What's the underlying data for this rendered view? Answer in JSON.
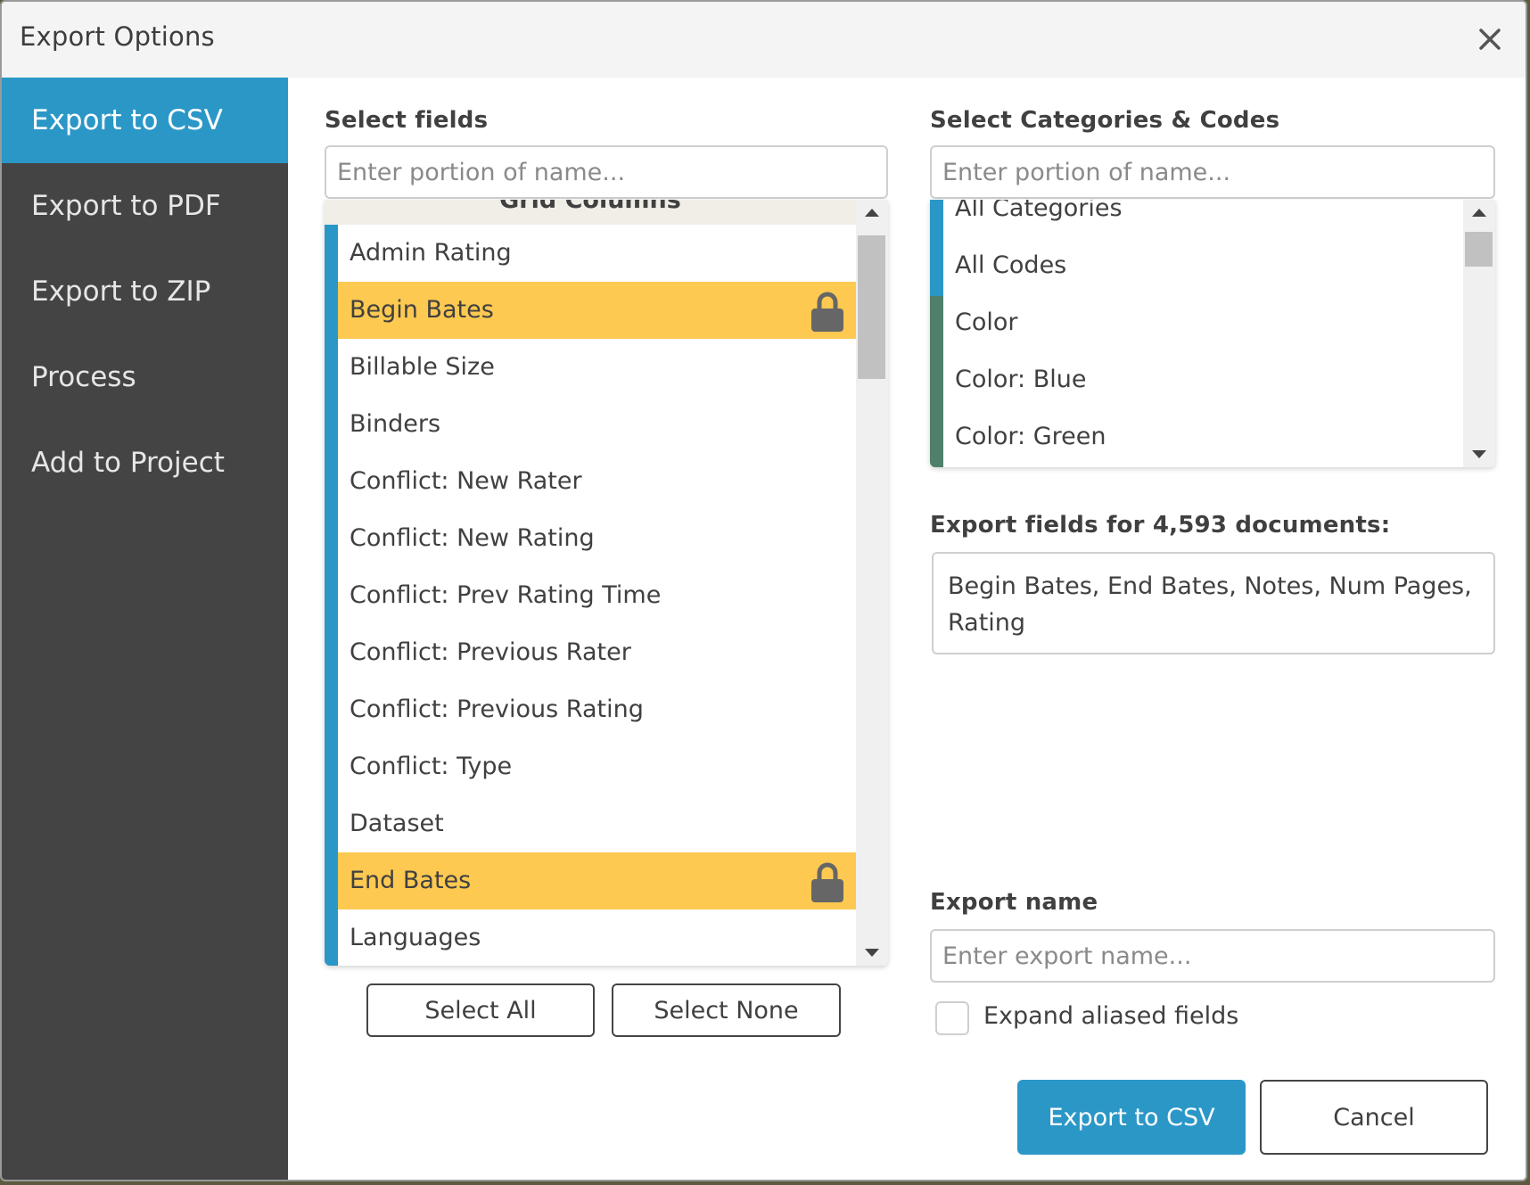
{
  "dialog": {
    "title": "Export Options",
    "close_icon": "close-icon"
  },
  "sidebar": {
    "items": [
      {
        "label": "Export to CSV",
        "active": true
      },
      {
        "label": "Export to PDF",
        "active": false
      },
      {
        "label": "Export to ZIP",
        "active": false
      },
      {
        "label": "Process",
        "active": false
      },
      {
        "label": "Add to Project",
        "active": false
      }
    ]
  },
  "fields": {
    "label": "Select fields",
    "search_placeholder": "Enter portion of name...",
    "group_header": "Grid Columns",
    "items": [
      {
        "label": "Admin Rating",
        "locked": false
      },
      {
        "label": "Begin Bates",
        "locked": true
      },
      {
        "label": "Billable Size",
        "locked": false
      },
      {
        "label": "Binders",
        "locked": false
      },
      {
        "label": "Conflict: New Rater",
        "locked": false
      },
      {
        "label": "Conflict: New Rating",
        "locked": false
      },
      {
        "label": "Conflict: Prev Rating Time",
        "locked": false
      },
      {
        "label": "Conflict: Previous Rater",
        "locked": false
      },
      {
        "label": "Conflict: Previous Rating",
        "locked": false
      },
      {
        "label": "Conflict: Type",
        "locked": false
      },
      {
        "label": "Dataset",
        "locked": false
      },
      {
        "label": "End Bates",
        "locked": true
      },
      {
        "label": "Languages",
        "locked": false
      }
    ],
    "select_all_label": "Select All",
    "select_none_label": "Select None"
  },
  "categories": {
    "label": "Select Categories & Codes",
    "search_placeholder": "Enter portion of name...",
    "items": [
      {
        "label": "All Categories",
        "group": "all"
      },
      {
        "label": "All Codes",
        "group": "all"
      },
      {
        "label": "Color",
        "group": "color"
      },
      {
        "label": "Color: Blue",
        "group": "color"
      },
      {
        "label": "Color: Green",
        "group": "color"
      }
    ]
  },
  "export_fields": {
    "label": "Export fields for 4,593 documents:",
    "value": "Begin Bates, End Bates, Notes, Num Pages, Rating"
  },
  "export_name": {
    "label": "Export name",
    "placeholder": "Enter export name...",
    "value": ""
  },
  "expand_aliased": {
    "label": "Expand aliased fields",
    "checked": false
  },
  "actions": {
    "primary_label": "Export to CSV",
    "cancel_label": "Cancel"
  },
  "colors": {
    "accent_blue": "#2b97c7",
    "sidebar_bg": "#444444",
    "locked_row": "#fdc951",
    "category_green": "#4e806b",
    "lock_icon": "#666666"
  }
}
